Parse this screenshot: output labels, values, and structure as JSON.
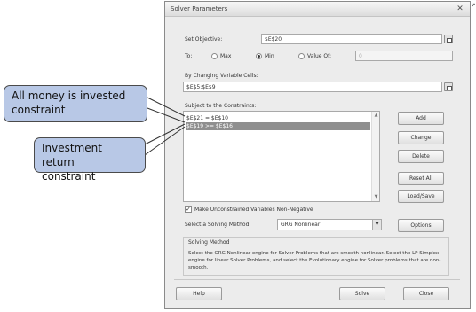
{
  "dialog": {
    "title": "Solver Parameters",
    "close_glyph": "✕"
  },
  "objective": {
    "label": "Set Objective:",
    "value": "$E$20"
  },
  "to": {
    "label": "To:",
    "options": [
      "Max",
      "Min",
      "Value Of:"
    ],
    "selected": "Min",
    "value_of": "0"
  },
  "changing_cells": {
    "label": "By Changing Variable Cells:",
    "value": "$E$5:$E$9"
  },
  "constraints": {
    "label": "Subject to the Constraints:",
    "items": [
      "$E$21 = $E$10",
      "$E$19 >= $E$16"
    ],
    "selected_index": 1
  },
  "side_buttons": {
    "add": "Add",
    "change": "Change",
    "delete": "Delete",
    "reset_all": "Reset All",
    "load_save": "Load/Save"
  },
  "nonneg": {
    "label": "Make Unconstrained Variables Non-Negative",
    "checked": true,
    "check_glyph": "✓"
  },
  "method": {
    "label": "Select a Solving Method:",
    "value": "GRG Nonlinear",
    "options_button": "Options"
  },
  "solving_method": {
    "title": "Solving Method",
    "text": "Select the GRG Nonlinear engine for Solver Problems that are smooth nonlinear. Select the LP Simplex engine for linear Solver Problems, and select the Evolutionary engine for Solver problems that are non-smooth."
  },
  "footer": {
    "help": "Help",
    "solve": "Solve",
    "close": "Close"
  },
  "callouts": {
    "money": "All money is invested\nconstraint",
    "return": "Investment return\nconstraint"
  },
  "colors": {
    "callout_fill": "#b8c8e6",
    "selection": "#8f8f8f"
  }
}
